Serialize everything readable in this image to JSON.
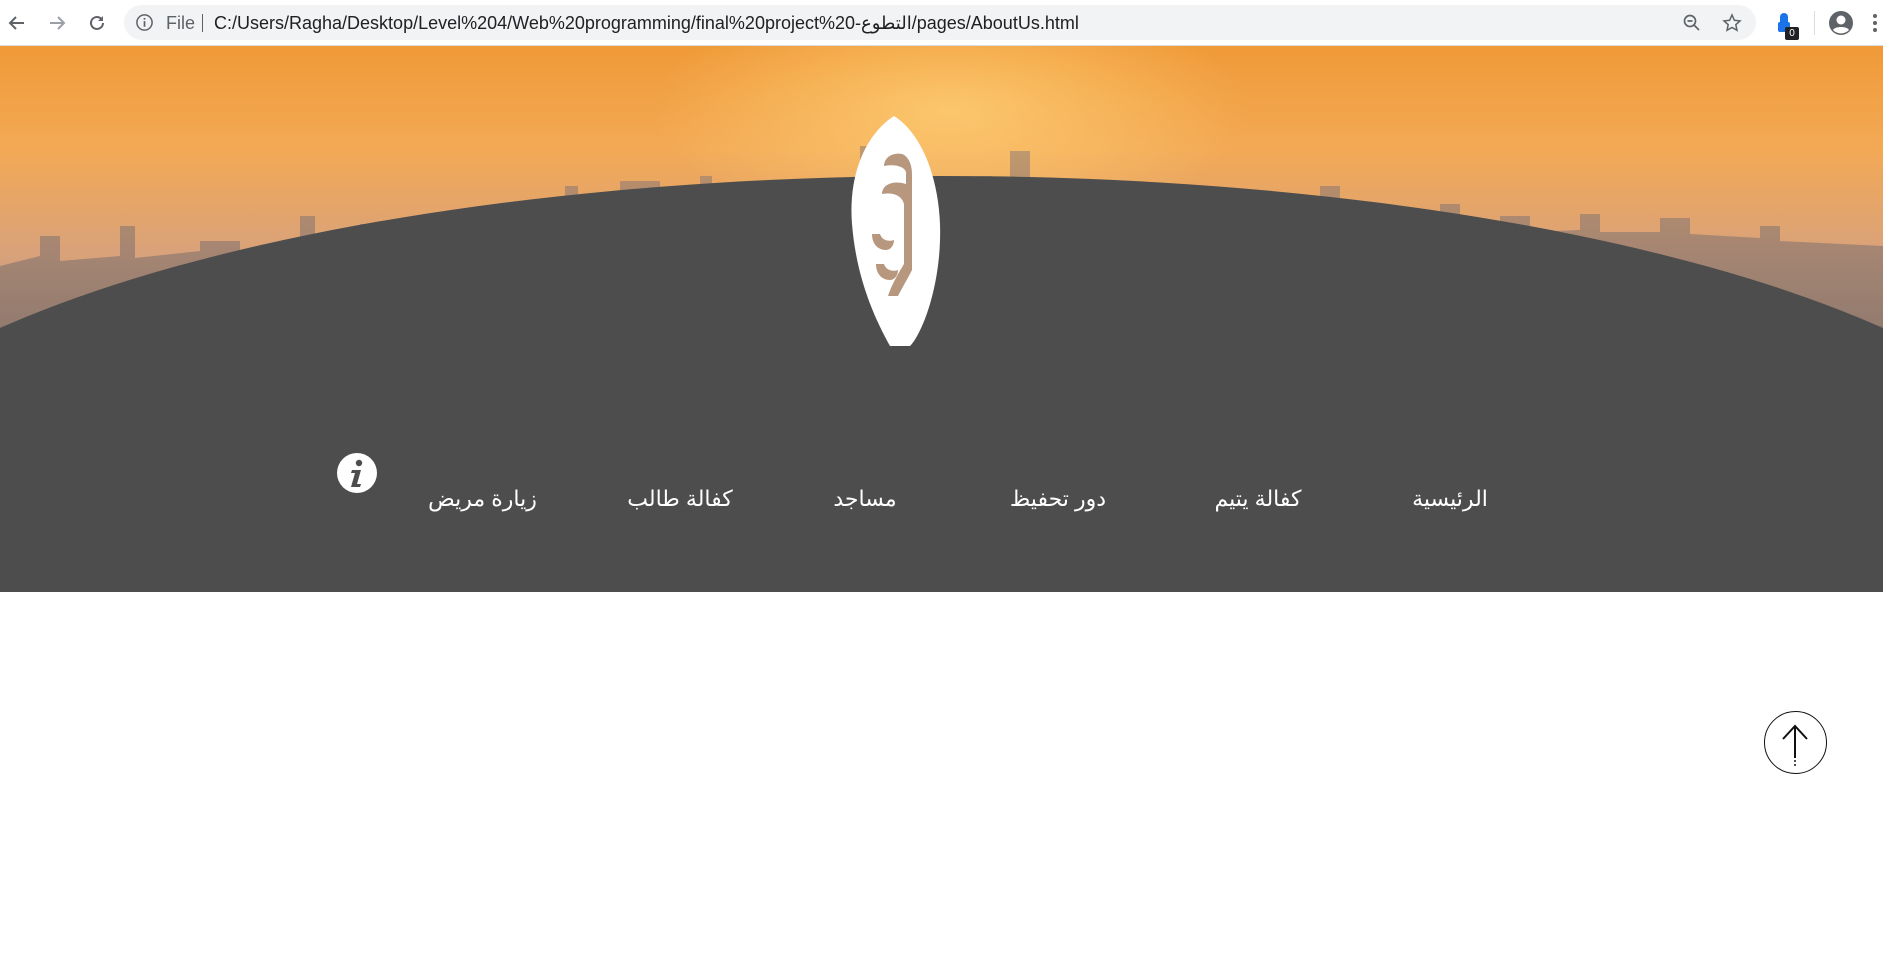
{
  "browser": {
    "back_icon": "arrow-left-icon",
    "forward_icon": "arrow-right-icon",
    "reload_icon": "reload-icon",
    "page_info_icon": "info-circle-icon",
    "file_label": "File",
    "url": "C:/Users/Ragha/Desktop/Level%204/Web%20programming/final%20project%20-التطوع/pages/AboutUs.html",
    "zoom_icon": "zoom-out-icon",
    "bookmark_icon": "star-icon",
    "extension_icon": "extension-icon",
    "extension_badge": "0",
    "profile_icon": "account-icon",
    "menu_icon": "kebab-menu-icon"
  },
  "header": {
    "logo_icon": "calligraphy-logo",
    "background": "city-skyline-sunset",
    "dark_color": "#4d4d4d"
  },
  "nav": {
    "items": [
      {
        "label": "الرئيسية"
      },
      {
        "label": "كفالة يتيم"
      },
      {
        "label": "دور تحفيظ"
      },
      {
        "label": "مساجد"
      },
      {
        "label": "كفالة طالب"
      },
      {
        "label": "زيارة مريض"
      }
    ],
    "info_icon": "info-icon"
  },
  "scroll_top": {
    "icon": "arrow-up-icon"
  }
}
